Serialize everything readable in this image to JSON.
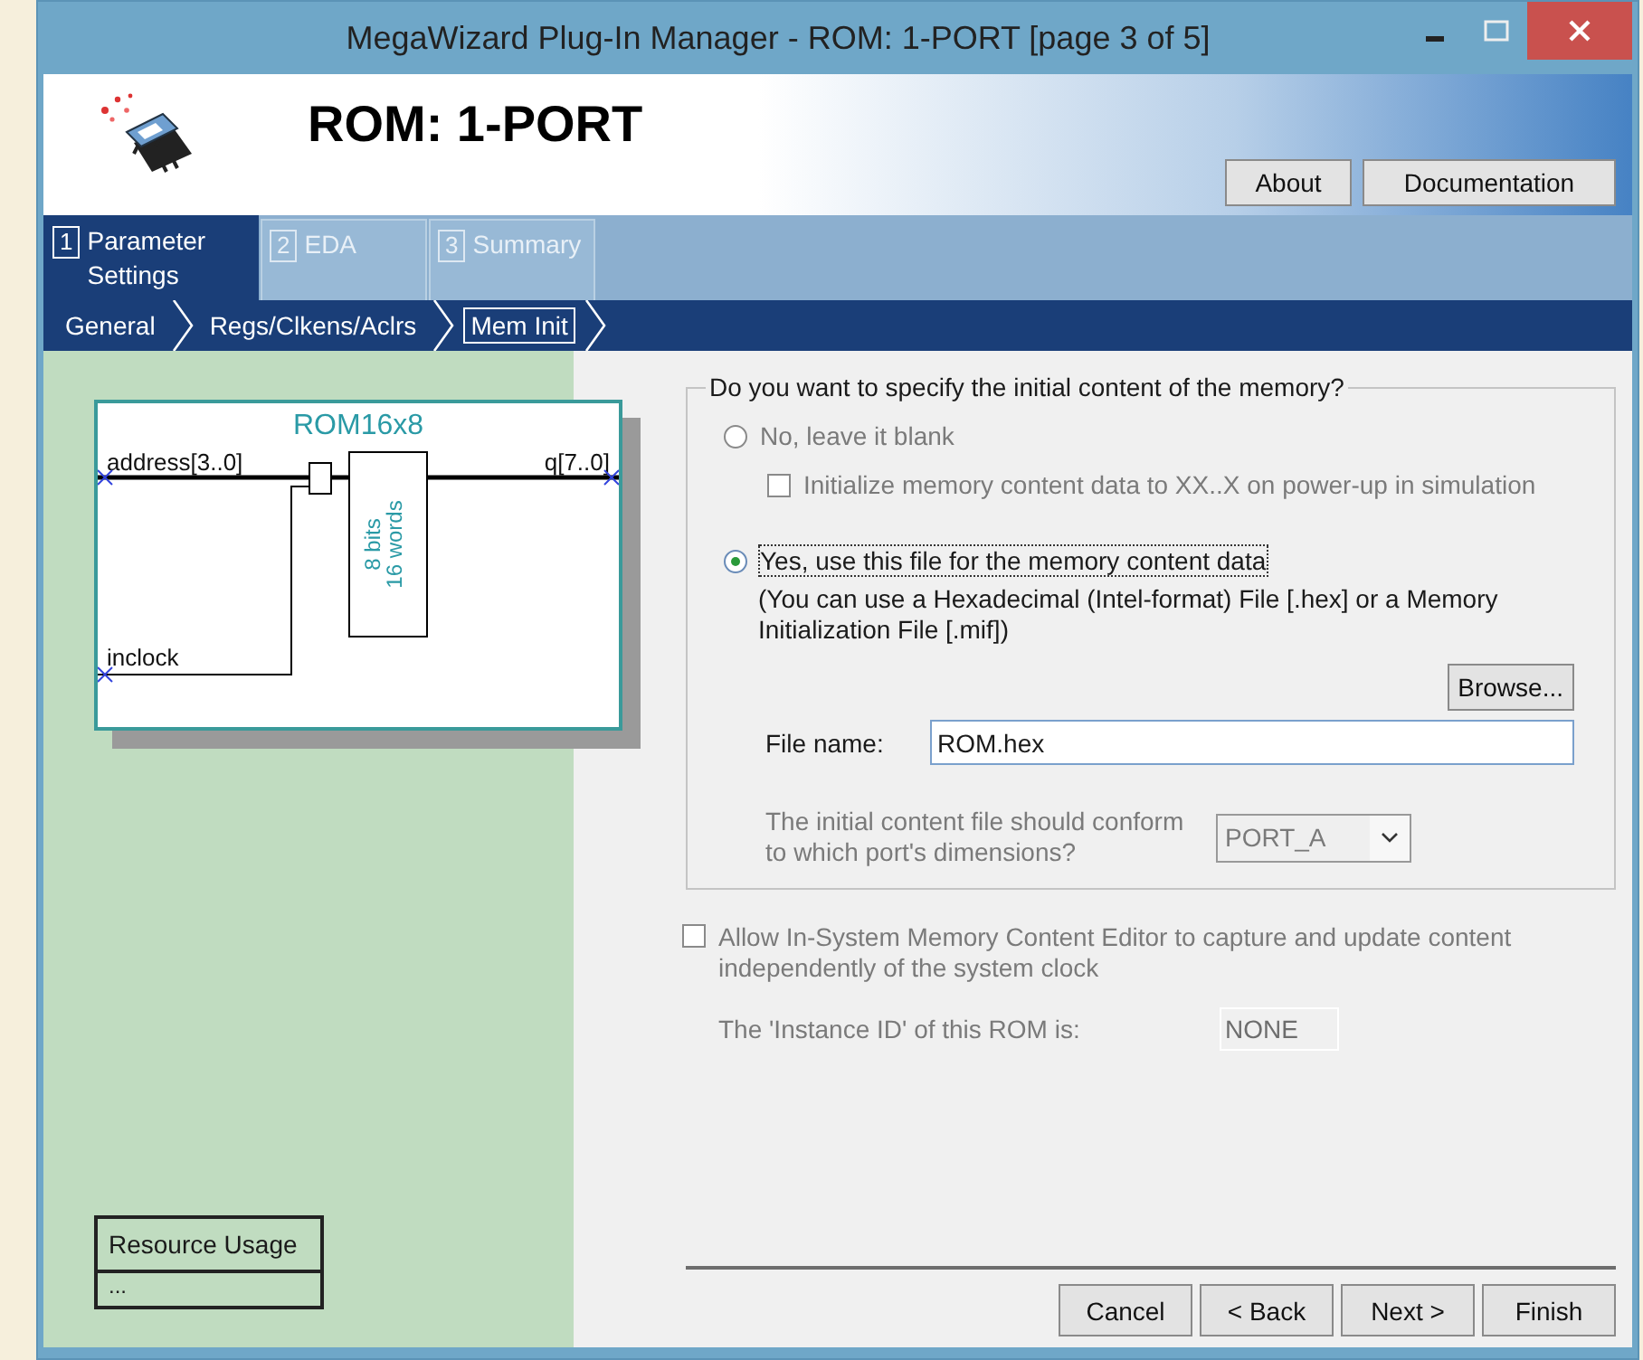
{
  "window": {
    "title": "MegaWizard Plug-In Manager - ROM: 1-PORT [page 3 of 5]"
  },
  "header": {
    "title": "ROM: 1-PORT",
    "buttons": [
      "About",
      "Documentation"
    ]
  },
  "tabs": [
    {
      "number": "1",
      "label": "Parameter Settings",
      "selected": true
    },
    {
      "number": "2",
      "label": "EDA",
      "selected": false
    },
    {
      "number": "3",
      "label": "Summary",
      "selected": false
    }
  ],
  "breadcrumb": [
    {
      "label": "General",
      "selected": false
    },
    {
      "label": "Regs/Clkens/Aclrs",
      "selected": false
    },
    {
      "label": "Mem Init",
      "selected": true
    }
  ],
  "diagram": {
    "title": "ROM16x8",
    "input_address": "address[3..0]",
    "input_clock": "inclock",
    "output": "q[7..0]",
    "block_line_1": "8 bits",
    "block_line_2": "16 words"
  },
  "resource_usage": {
    "title": "Resource Usage",
    "value": "..."
  },
  "memory_group": {
    "legend": "Do you want to specify the initial content of the memory?",
    "options": [
      {
        "label": "No, leave it blank",
        "selected": false,
        "disabled": true
      },
      {
        "label": "Yes, use this file for the memory content data",
        "selected": true,
        "disabled": false
      }
    ],
    "init_checkbox": {
      "label": "Initialize memory content data to XX..X on power-up in simulation",
      "checked": false,
      "disabled": true
    },
    "note": "(You can use a Hexadecimal (Intel-format) File [.hex] or a Memory Initialization File [.mif])",
    "browse_button": "Browse...",
    "file_name": {
      "label": "File name:",
      "value": "ROM.hex"
    },
    "port": {
      "label": "The initial content file should conform to which port's dimensions?",
      "value": "PORT_A",
      "disabled": true
    }
  },
  "in_system": {
    "label": "Allow In-System Memory Content Editor to capture and update content independently of the system clock",
    "checked": false,
    "disabled": true,
    "instance_label": "The 'Instance ID' of this ROM is:",
    "instance_value": "NONE"
  },
  "buttons": [
    "Cancel",
    "< Back",
    "Next >",
    "Finish"
  ]
}
